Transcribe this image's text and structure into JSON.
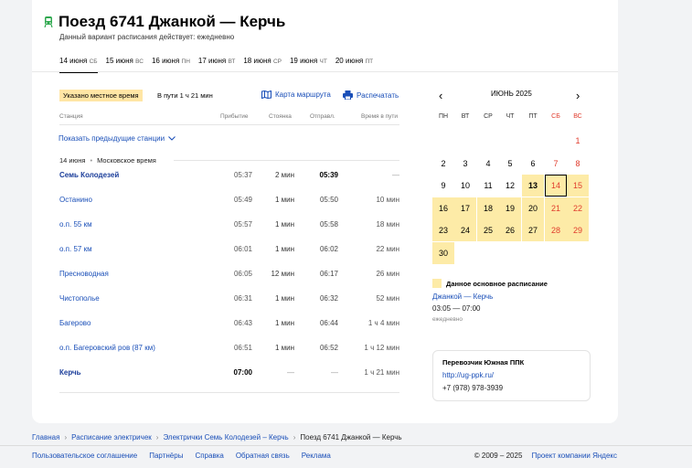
{
  "header": {
    "title": "Поезд 6741 Джанкой — Керчь",
    "subtitle": "Данный вариант расписания действует: ежедневно"
  },
  "tabs": [
    {
      "date": "14 июня",
      "dow": "СБ",
      "active": true
    },
    {
      "date": "15 июня",
      "dow": "ВС"
    },
    {
      "date": "16 июня",
      "dow": "ПН"
    },
    {
      "date": "17 июня",
      "dow": "ВТ"
    },
    {
      "date": "18 июня",
      "dow": "СР"
    },
    {
      "date": "19 июня",
      "dow": "ЧТ"
    },
    {
      "date": "20 июня",
      "dow": "ПТ"
    }
  ],
  "info": {
    "local_time_badge": "Указано местное время",
    "trip_duration": "В пути 1 ч 21 мин",
    "map_link": "Карта маршрута",
    "print_link": "Распечатать"
  },
  "table": {
    "headers": {
      "station": "Станция",
      "arrival": "Прибытие",
      "stop": "Стоянка",
      "departure": "Отправл.",
      "travel": "Время в пути"
    },
    "show_previous": "Показать предыдущие станции",
    "date_label": "14 июня",
    "timezone": "Московское время",
    "rows": [
      {
        "station": "Семь Колодезей",
        "arrival": "05:37",
        "stop": "2 мин",
        "departure": "05:39",
        "travel": "—"
      },
      {
        "station": "Останино",
        "arrival": "05:49",
        "stop": "1 мин",
        "departure": "05:50",
        "travel": "10 мин"
      },
      {
        "station": "о.п. 55 км",
        "arrival": "05:57",
        "stop": "1 мин",
        "departure": "05:58",
        "travel": "18 мин"
      },
      {
        "station": "о.п. 57 км",
        "arrival": "06:01",
        "stop": "1 мин",
        "departure": "06:02",
        "travel": "22 мин"
      },
      {
        "station": "Пресноводная",
        "arrival": "06:05",
        "stop": "12 мин",
        "departure": "06:17",
        "travel": "26 мин"
      },
      {
        "station": "Чистополье",
        "arrival": "06:31",
        "stop": "1 мин",
        "departure": "06:32",
        "travel": "52 мин"
      },
      {
        "station": "Багерово",
        "arrival": "06:43",
        "stop": "1 мин",
        "departure": "06:44",
        "travel": "1 ч 4 мин"
      },
      {
        "station": "о.п. Багеровский ров (87 км)",
        "arrival": "06:51",
        "stop": "1 мин",
        "departure": "06:52",
        "travel": "1 ч 12 мин"
      },
      {
        "station": "Керчь",
        "arrival": "07:00",
        "stop": "—",
        "departure": "—",
        "travel": "1 ч 21 мин"
      }
    ]
  },
  "calendar": {
    "month": "ИЮНЬ 2025",
    "prev_icon": "‹",
    "next_icon": "›",
    "weekdays": [
      "ПН",
      "ВТ",
      "СР",
      "ЧТ",
      "ПТ",
      "СБ",
      "ВС"
    ],
    "today": 13,
    "selected": 14,
    "highlight_from": 13,
    "highlight_color": "#fdeba7",
    "weekend_color": "#e03c2d",
    "days_in_month": 30,
    "first_weekday_index": 6
  },
  "legend": {
    "label": "Данное основное расписание",
    "route": "Джанкой — Керчь",
    "time": "03:05 — 07:00",
    "frequency": "ежедневно"
  },
  "carrier": {
    "name": "Перевозчик Южная ППК",
    "url": "http://ug-ppk.ru/",
    "phone": "+7 (978) 978-3939"
  },
  "breadcrumbs": [
    "Главная",
    "Расписание электричек",
    "Электрички Семь Колодезей – Керчь",
    "Поезд 6741 Джанкой — Керчь"
  ],
  "footer": {
    "links": [
      "Пользовательское соглашение",
      "Партнёры",
      "Справка",
      "Обратная связь",
      "Реклама"
    ],
    "copyright": "© 2009 – 2025",
    "company": "Проект компании Яндекс"
  }
}
